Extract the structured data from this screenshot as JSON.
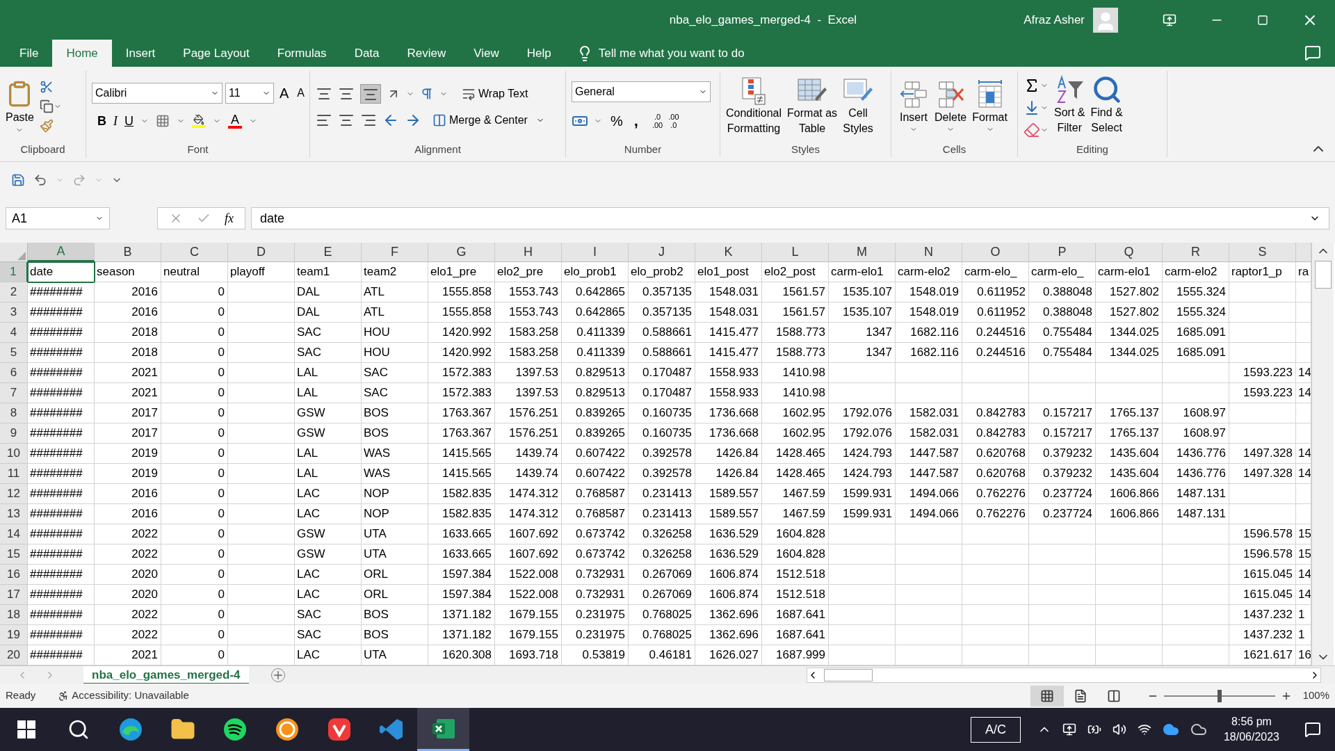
{
  "window": {
    "title": "nba_elo_games_merged-4  -  Excel",
    "user": "Afraz Asher"
  },
  "menu_tabs": [
    {
      "label": "File",
      "selected": false
    },
    {
      "label": "Home",
      "selected": true
    },
    {
      "label": "Insert",
      "selected": false
    },
    {
      "label": "Page Layout",
      "selected": false
    },
    {
      "label": "Formulas",
      "selected": false
    },
    {
      "label": "Data",
      "selected": false
    },
    {
      "label": "Review",
      "selected": false
    },
    {
      "label": "View",
      "selected": false
    },
    {
      "label": "Help",
      "selected": false
    }
  ],
  "tell_me": "Tell me what you want to do",
  "ribbon": {
    "clipboard": {
      "label": "Clipboard",
      "paste": "Paste"
    },
    "font": {
      "label": "Font",
      "family": "Calibri",
      "size": "11",
      "grow": "A",
      "shrink": "A",
      "bold": "B",
      "italic": "I",
      "underline": "U",
      "font_color": "A"
    },
    "alignment": {
      "label": "Alignment",
      "wrap_text": "Wrap Text",
      "merge_center": "Merge & Center",
      "bottom_align_selected": true
    },
    "number": {
      "label": "Number",
      "format": "General",
      "percent": "%",
      "comma": ",",
      "increase_decimal": [
        ".0",
        ".00"
      ],
      "decrease_decimal": [
        ".00",
        ".0"
      ]
    },
    "styles": {
      "label": "Styles",
      "buttons": [
        {
          "kind": "conditional",
          "lines": [
            "Conditional",
            "Formatting"
          ]
        },
        {
          "kind": "table",
          "lines": [
            "Format as",
            "Table"
          ]
        },
        {
          "kind": "cellstyles",
          "lines": [
            "Cell",
            "Styles"
          ]
        }
      ]
    },
    "cells": {
      "label": "Cells",
      "buttons": [
        {
          "kind": "insert",
          "label": "Insert"
        },
        {
          "kind": "delete",
          "label": "Delete"
        },
        {
          "kind": "format",
          "label": "Format"
        }
      ]
    },
    "editing": {
      "label": "Editing",
      "buttons": [
        {
          "kind": "sort",
          "lines": [
            "Sort &",
            "Filter"
          ]
        },
        {
          "kind": "find",
          "lines": [
            "Find &",
            "Select"
          ]
        }
      ]
    }
  },
  "formula_bar": {
    "name_box": "A1",
    "fx": "fx",
    "value": "date"
  },
  "grid": {
    "columns": [
      {
        "label": "A",
        "kind": "text",
        "selected": true
      },
      {
        "label": "B",
        "kind": "number",
        "selected": false
      },
      {
        "label": "C",
        "kind": "number",
        "selected": false
      },
      {
        "label": "D",
        "kind": "text",
        "selected": false
      },
      {
        "label": "E",
        "kind": "text",
        "selected": false
      },
      {
        "label": "F",
        "kind": "text",
        "selected": false
      },
      {
        "label": "G",
        "kind": "number",
        "selected": false
      },
      {
        "label": "H",
        "kind": "number",
        "selected": false
      },
      {
        "label": "I",
        "kind": "number",
        "selected": false
      },
      {
        "label": "J",
        "kind": "number",
        "selected": false
      },
      {
        "label": "K",
        "kind": "number",
        "selected": false
      },
      {
        "label": "L",
        "kind": "number",
        "selected": false
      },
      {
        "label": "M",
        "kind": "number",
        "selected": false
      },
      {
        "label": "N",
        "kind": "number",
        "selected": false
      },
      {
        "label": "O",
        "kind": "number",
        "selected": false
      },
      {
        "label": "P",
        "kind": "number",
        "selected": false
      },
      {
        "label": "Q",
        "kind": "number",
        "selected": false
      },
      {
        "label": "R",
        "kind": "number",
        "selected": false
      },
      {
        "label": "S",
        "kind": "number",
        "selected": false
      },
      {
        "kind": "partial",
        "selected": false
      }
    ],
    "rows": [
      {
        "number": "1",
        "kind": "labels",
        "selected": true,
        "cells": [
          "date",
          "season",
          "neutral",
          "playoff",
          "team1",
          "team2",
          "elo1_pre",
          "elo2_pre",
          "elo_prob1",
          "elo_prob2",
          "elo1_post",
          "elo2_post",
          "carm-elo1",
          "carm-elo2",
          "carm-elo_",
          "carm-elo_",
          "carm-elo1",
          "carm-elo2",
          "raptor1_p",
          "ra"
        ]
      },
      {
        "number": "2",
        "kind": "data",
        "selected": false,
        "cells": [
          "########",
          "2016",
          "0",
          null,
          "DAL",
          "ATL",
          "1555.858",
          "1553.743",
          "0.642865",
          "0.357135",
          "1548.031",
          "1561.57",
          "1535.107",
          "1548.019",
          "0.611952",
          "0.388048",
          "1527.802",
          "1555.324",
          null,
          null
        ]
      },
      {
        "number": "3",
        "kind": "data",
        "selected": false,
        "cells": [
          "########",
          "2016",
          "0",
          null,
          "DAL",
          "ATL",
          "1555.858",
          "1553.743",
          "0.642865",
          "0.357135",
          "1548.031",
          "1561.57",
          "1535.107",
          "1548.019",
          "0.611952",
          "0.388048",
          "1527.802",
          "1555.324",
          null,
          null
        ]
      },
      {
        "number": "4",
        "kind": "data",
        "selected": false,
        "cells": [
          "########",
          "2018",
          "0",
          null,
          "SAC",
          "HOU",
          "1420.992",
          "1583.258",
          "0.411339",
          "0.588661",
          "1415.477",
          "1588.773",
          "1347",
          "1682.116",
          "0.244516",
          "0.755484",
          "1344.025",
          "1685.091",
          null,
          null
        ]
      },
      {
        "number": "5",
        "kind": "data",
        "selected": false,
        "cells": [
          "########",
          "2018",
          "0",
          null,
          "SAC",
          "HOU",
          "1420.992",
          "1583.258",
          "0.411339",
          "0.588661",
          "1415.477",
          "1588.773",
          "1347",
          "1682.116",
          "0.244516",
          "0.755484",
          "1344.025",
          "1685.091",
          null,
          null
        ]
      },
      {
        "number": "6",
        "kind": "data",
        "selected": false,
        "cells": [
          "########",
          "2021",
          "0",
          null,
          "LAL",
          "SAC",
          "1572.383",
          "1397.53",
          "0.829513",
          "0.170487",
          "1558.933",
          "1410.98",
          null,
          null,
          null,
          null,
          null,
          null,
          "1593.223",
          "14"
        ]
      },
      {
        "number": "7",
        "kind": "data",
        "selected": false,
        "cells": [
          "########",
          "2021",
          "0",
          null,
          "LAL",
          "SAC",
          "1572.383",
          "1397.53",
          "0.829513",
          "0.170487",
          "1558.933",
          "1410.98",
          null,
          null,
          null,
          null,
          null,
          null,
          "1593.223",
          "14"
        ]
      },
      {
        "number": "8",
        "kind": "data",
        "selected": false,
        "cells": [
          "########",
          "2017",
          "0",
          null,
          "GSW",
          "BOS",
          "1763.367",
          "1576.251",
          "0.839265",
          "0.160735",
          "1736.668",
          "1602.95",
          "1792.076",
          "1582.031",
          "0.842783",
          "0.157217",
          "1765.137",
          "1608.97",
          null,
          null
        ]
      },
      {
        "number": "9",
        "kind": "data",
        "selected": false,
        "cells": [
          "########",
          "2017",
          "0",
          null,
          "GSW",
          "BOS",
          "1763.367",
          "1576.251",
          "0.839265",
          "0.160735",
          "1736.668",
          "1602.95",
          "1792.076",
          "1582.031",
          "0.842783",
          "0.157217",
          "1765.137",
          "1608.97",
          null,
          null
        ]
      },
      {
        "number": "10",
        "kind": "data",
        "selected": false,
        "cells": [
          "########",
          "2019",
          "0",
          null,
          "LAL",
          "WAS",
          "1415.565",
          "1439.74",
          "0.607422",
          "0.392578",
          "1426.84",
          "1428.465",
          "1424.793",
          "1447.587",
          "0.620768",
          "0.379232",
          "1435.604",
          "1436.776",
          "1497.328",
          "14"
        ]
      },
      {
        "number": "11",
        "kind": "data",
        "selected": false,
        "cells": [
          "########",
          "2019",
          "0",
          null,
          "LAL",
          "WAS",
          "1415.565",
          "1439.74",
          "0.607422",
          "0.392578",
          "1426.84",
          "1428.465",
          "1424.793",
          "1447.587",
          "0.620768",
          "0.379232",
          "1435.604",
          "1436.776",
          "1497.328",
          "14"
        ]
      },
      {
        "number": "12",
        "kind": "data",
        "selected": false,
        "cells": [
          "########",
          "2016",
          "0",
          null,
          "LAC",
          "NOP",
          "1582.835",
          "1474.312",
          "0.768587",
          "0.231413",
          "1589.557",
          "1467.59",
          "1599.931",
          "1494.066",
          "0.762276",
          "0.237724",
          "1606.866",
          "1487.131",
          null,
          null
        ]
      },
      {
        "number": "13",
        "kind": "data",
        "selected": false,
        "cells": [
          "########",
          "2016",
          "0",
          null,
          "LAC",
          "NOP",
          "1582.835",
          "1474.312",
          "0.768587",
          "0.231413",
          "1589.557",
          "1467.59",
          "1599.931",
          "1494.066",
          "0.762276",
          "0.237724",
          "1606.866",
          "1487.131",
          null,
          null
        ]
      },
      {
        "number": "14",
        "kind": "data",
        "selected": false,
        "cells": [
          "########",
          "2022",
          "0",
          null,
          "GSW",
          "UTA",
          "1633.665",
          "1607.692",
          "0.673742",
          "0.326258",
          "1636.529",
          "1604.828",
          null,
          null,
          null,
          null,
          null,
          null,
          "1596.578",
          "15"
        ]
      },
      {
        "number": "15",
        "kind": "data",
        "selected": false,
        "cells": [
          "########",
          "2022",
          "0",
          null,
          "GSW",
          "UTA",
          "1633.665",
          "1607.692",
          "0.673742",
          "0.326258",
          "1636.529",
          "1604.828",
          null,
          null,
          null,
          null,
          null,
          null,
          "1596.578",
          "15"
        ]
      },
      {
        "number": "16",
        "kind": "data",
        "selected": false,
        "cells": [
          "########",
          "2020",
          "0",
          null,
          "LAC",
          "ORL",
          "1597.384",
          "1522.008",
          "0.732931",
          "0.267069",
          "1606.874",
          "1512.518",
          null,
          null,
          null,
          null,
          null,
          null,
          "1615.045",
          "14"
        ]
      },
      {
        "number": "17",
        "kind": "data",
        "selected": false,
        "cells": [
          "########",
          "2020",
          "0",
          null,
          "LAC",
          "ORL",
          "1597.384",
          "1522.008",
          "0.732931",
          "0.267069",
          "1606.874",
          "1512.518",
          null,
          null,
          null,
          null,
          null,
          null,
          "1615.045",
          "14"
        ]
      },
      {
        "number": "18",
        "kind": "data",
        "selected": false,
        "cells": [
          "########",
          "2022",
          "0",
          null,
          "SAC",
          "BOS",
          "1371.182",
          "1679.155",
          "0.231975",
          "0.768025",
          "1362.696",
          "1687.641",
          null,
          null,
          null,
          null,
          null,
          null,
          "1437.232",
          "1"
        ]
      },
      {
        "number": "19",
        "kind": "data",
        "selected": false,
        "cells": [
          "########",
          "2022",
          "0",
          null,
          "SAC",
          "BOS",
          "1371.182",
          "1679.155",
          "0.231975",
          "0.768025",
          "1362.696",
          "1687.641",
          null,
          null,
          null,
          null,
          null,
          null,
          "1437.232",
          "1"
        ]
      },
      {
        "number": "20",
        "kind": "data",
        "selected": false,
        "cells": [
          "########",
          "2021",
          "0",
          null,
          "LAC",
          "UTA",
          "1620.308",
          "1693.718",
          "0.53819",
          "0.46181",
          "1626.027",
          "1687.999",
          null,
          null,
          null,
          null,
          null,
          null,
          "1621.617",
          "16"
        ]
      }
    ]
  },
  "sheet_tabs": [
    {
      "label": "nba_elo_games_merged-4",
      "selected": true
    }
  ],
  "status_bar": {
    "mode": "Ready",
    "accessibility": "Accessibility: Unavailable",
    "zoom": "100%",
    "level": 0.5,
    "views": [
      {
        "kind": "normal",
        "selected": true
      },
      {
        "kind": "layout",
        "selected": false
      },
      {
        "kind": "pagebreak",
        "selected": false
      }
    ]
  },
  "taskbar": {
    "apps": [
      {
        "kind": "start",
        "selected": false
      },
      {
        "kind": "search",
        "selected": false
      },
      {
        "kind": "browser",
        "selected": false
      },
      {
        "kind": "folder",
        "selected": false
      },
      {
        "kind": "music",
        "selected": false
      },
      {
        "kind": "coin",
        "selected": false
      },
      {
        "kind": "shield",
        "selected": false
      },
      {
        "kind": "code",
        "selected": false
      },
      {
        "kind": "sheet",
        "selected": true
      }
    ],
    "ac": "A/C",
    "time": "8:56 pm",
    "date": "18/06/2023"
  }
}
